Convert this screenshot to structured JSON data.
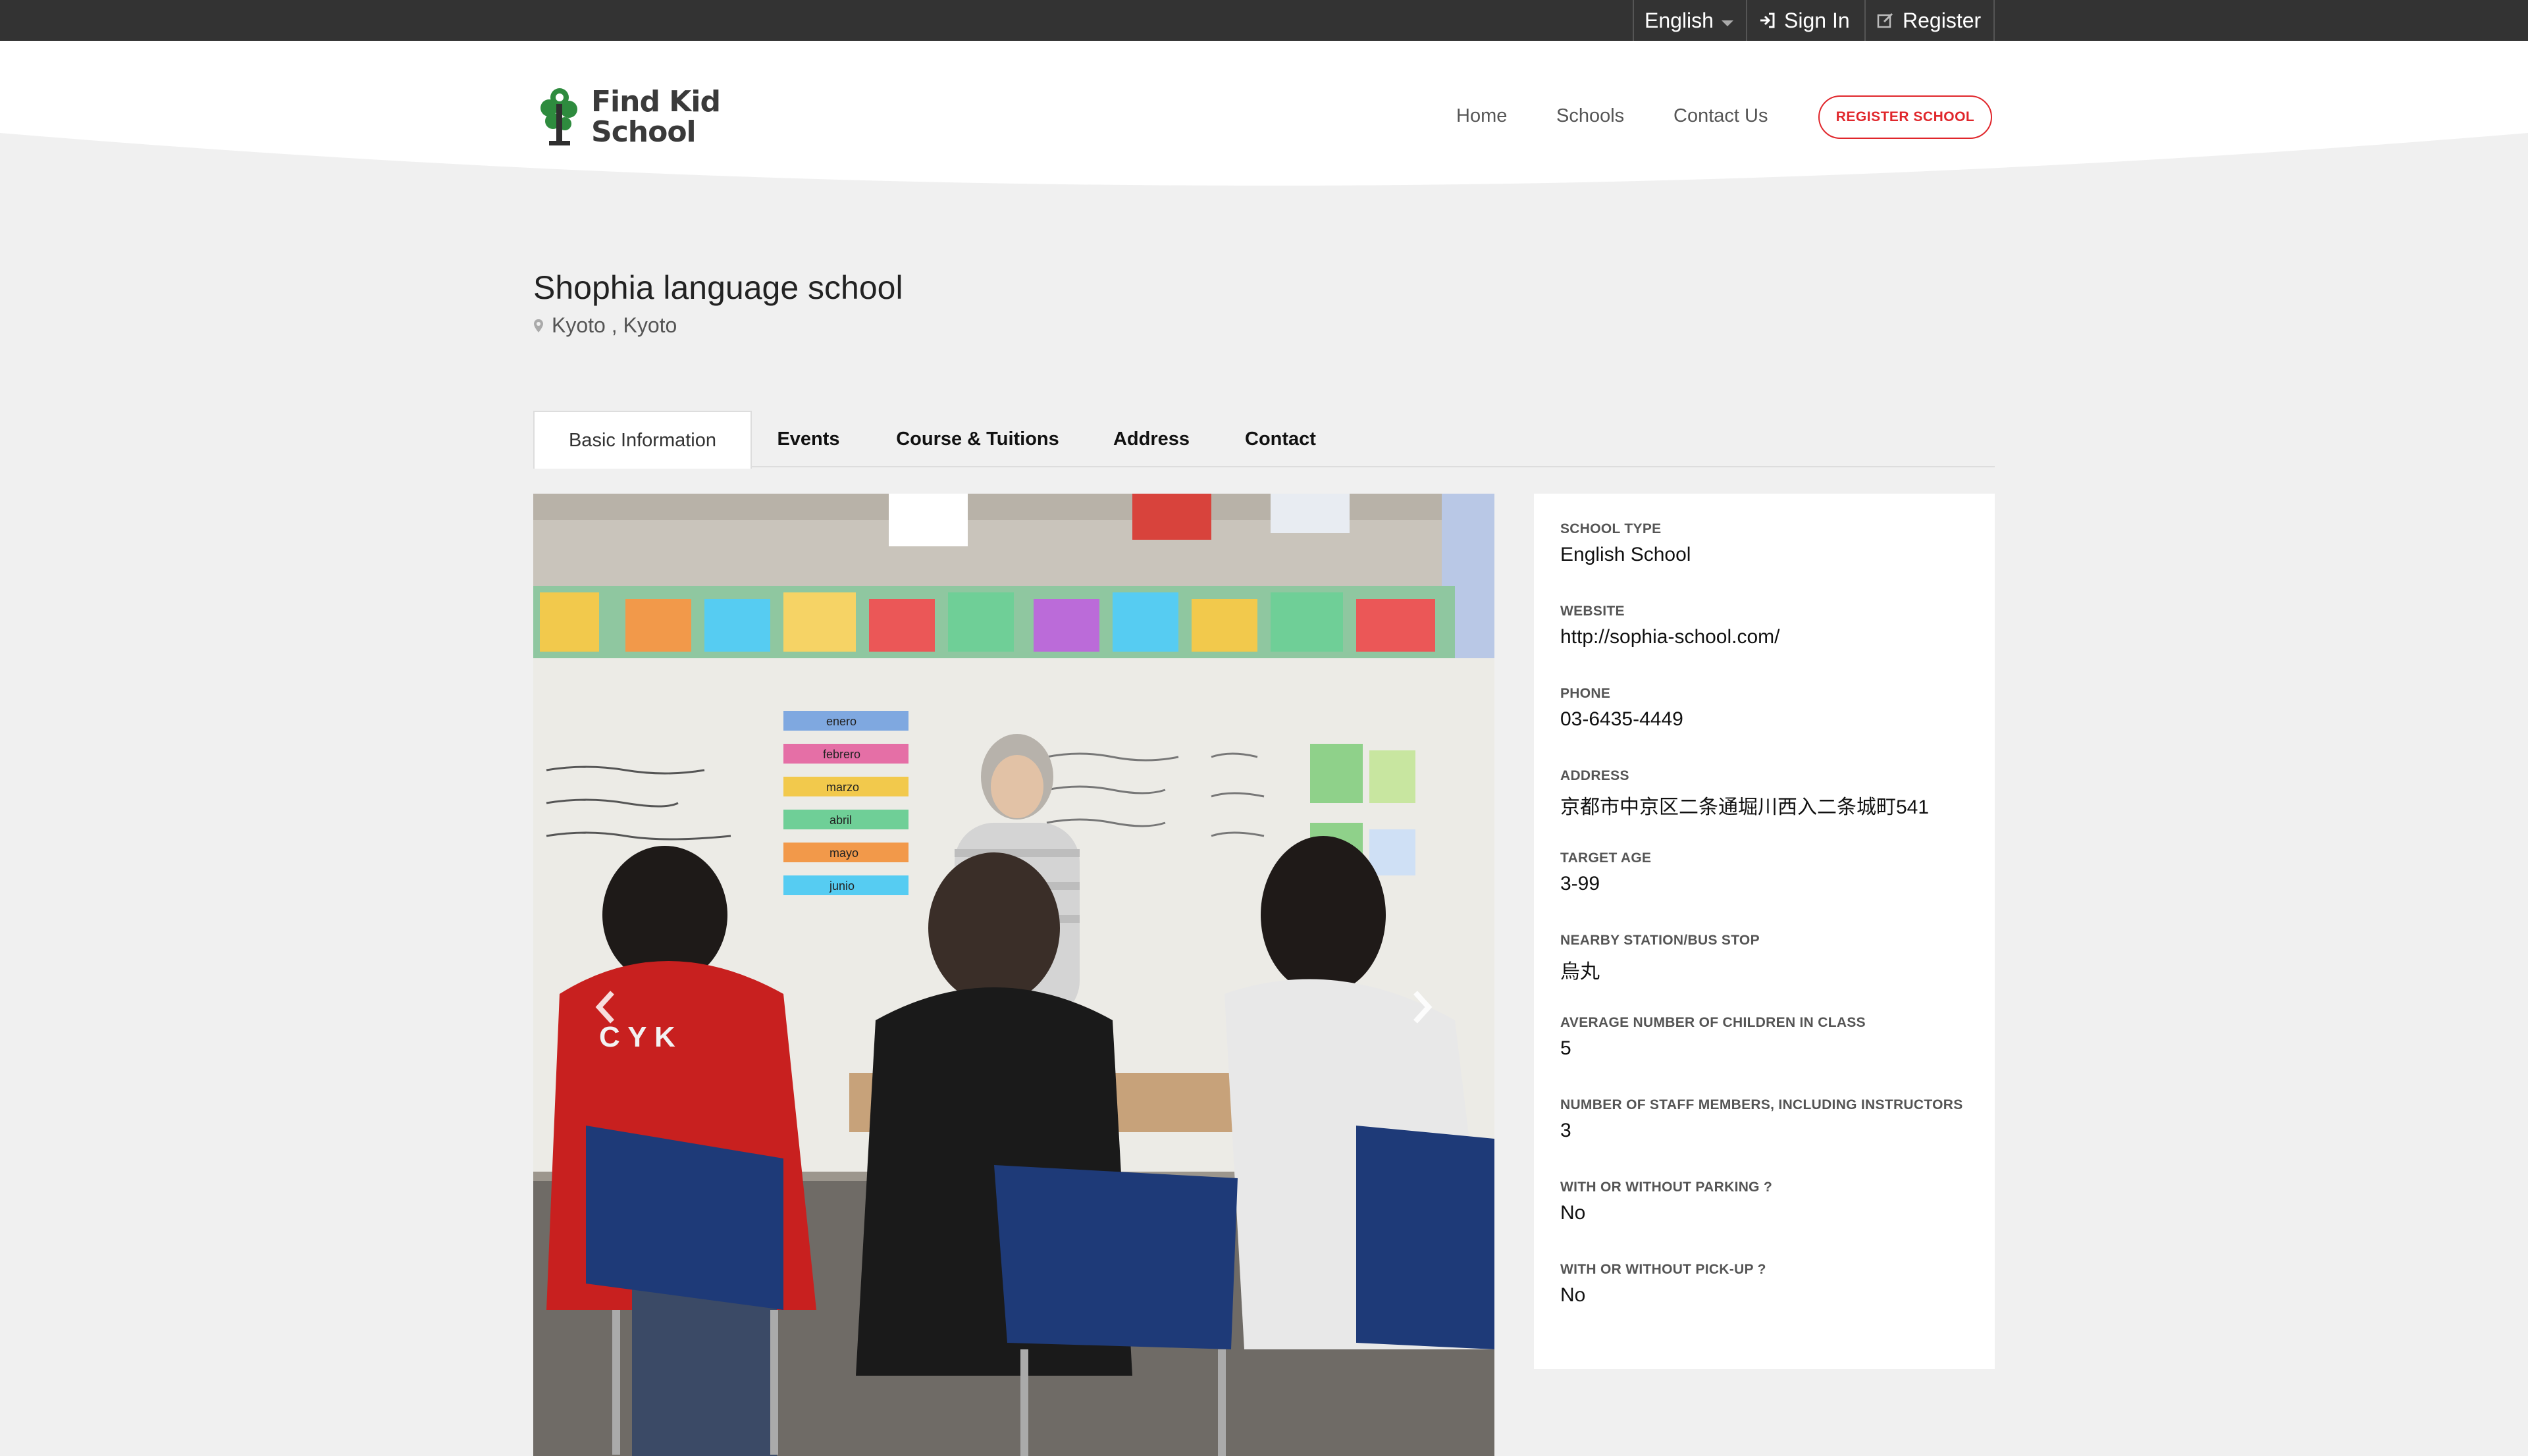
{
  "topbar": {
    "language": "English",
    "sign_in": "Sign In",
    "register": "Register"
  },
  "brand": {
    "name_line1": "Find Kid",
    "name_line2": "School",
    "logo_color": "#2e8b3e"
  },
  "nav": {
    "home": "Home",
    "schools": "Schools",
    "contact": "Contact Us",
    "register_school": "REGISTER SCHOOL"
  },
  "school": {
    "title": "Shophia language school",
    "location": "Kyoto , Kyoto"
  },
  "tabs": [
    {
      "label": "Basic Information",
      "active": true
    },
    {
      "label": "Events",
      "active": false
    },
    {
      "label": "Course & Tuitions",
      "active": false
    },
    {
      "label": "Address",
      "active": false
    },
    {
      "label": "Contact",
      "active": false
    }
  ],
  "info": [
    {
      "label": "SCHOOL TYPE",
      "value": "English School"
    },
    {
      "label": "WEBSITE",
      "value": "http://sophia-school.com/"
    },
    {
      "label": "PHONE",
      "value": "03-6435-4449"
    },
    {
      "label": "ADDRESS",
      "value": "京都市中京区二条通堀川西入二条城町541"
    },
    {
      "label": "TARGET AGE",
      "value": "3-99"
    },
    {
      "label": "NEARBY STATION/BUS STOP",
      "value": "烏丸"
    },
    {
      "label": "AVERAGE NUMBER OF CHILDREN IN CLASS",
      "value": "5"
    },
    {
      "label": "NUMBER OF STAFF MEMBERS, INCLUDING INSTRUCTORS",
      "value": "3"
    },
    {
      "label": "WITH OR WITHOUT PARKING ?",
      "value": "No"
    },
    {
      "label": "WITH OR WITHOUT PICK-UP ?",
      "value": "No"
    }
  ],
  "photo": {
    "board_words": [
      "enero",
      "febrero",
      "marzo",
      "abril",
      "mayo",
      "junio"
    ],
    "hoodie_text": "C Y K"
  },
  "colors": {
    "accent": "#e0262b",
    "topbar": "#333333",
    "page_bg": "#f0f0f0"
  }
}
